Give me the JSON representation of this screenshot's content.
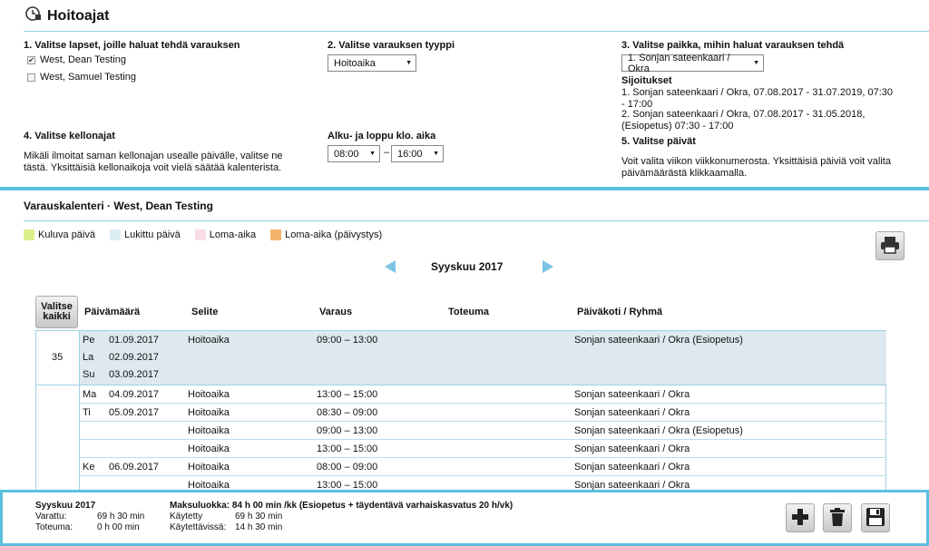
{
  "header": {
    "title": "Hoitoajat"
  },
  "section1": {
    "label": "1. Valitse lapset, joille haluat tehdä varauksen",
    "children": [
      {
        "name": "West, Dean Testing",
        "checked": true,
        "mark": "✔"
      },
      {
        "name": "West, Samuel Testing",
        "checked": false,
        "mark": ""
      }
    ]
  },
  "section2": {
    "label": "2. Valitse varauksen tyyppi",
    "selected": "Hoitoaika"
  },
  "section3": {
    "label": "3. Valitse paikka, mihin haluat varauksen tehdä",
    "selected": "1. Sonjan sateenkaari / Okra",
    "placements_title": "Sijoitukset",
    "placement1": "1. Sonjan sateenkaari / Okra, 07.08.2017 - 31.07.2019, 07:30 - 17:00",
    "placement2": "2. Sonjan sateenkaari / Okra, 07.08.2017 - 31.05.2018, (Esiopetus) 07:30 - 17:00"
  },
  "section4": {
    "label": "4. Valitse kellonajat",
    "help": "Mikäli ilmoitat saman kellonajan usealle päivälle, valitse ne tästä. Yksittäisiä kellonaikoja voit vielä säätää kalenterista."
  },
  "time": {
    "label": "Alku- ja loppu klo. aika",
    "start": "08:00",
    "dash": "–",
    "end": "16:00"
  },
  "section5": {
    "label": "5. Valitse päivät",
    "help": "Voit valita viikon viikkonumerosta. Yksittäisiä päiviä voit valita päivämäärästä klikkaamalla."
  },
  "calendar": {
    "title": "Varauskalenteri · West, Dean Testing",
    "legend": [
      {
        "label": "Kuluva päivä",
        "color": "#d9f08d"
      },
      {
        "label": "Lukittu päivä",
        "color": "#dbeef3"
      },
      {
        "label": "Loma-aika",
        "color": "#f8dde7"
      },
      {
        "label": "Loma-aika (päivystys)",
        "color": "#f4b36a"
      }
    ],
    "month": "Syyskuu 2017",
    "select_all": "Valitse kaikki",
    "columns": [
      "Päivämäärä",
      "Selite",
      "Varaus",
      "Toteuma",
      "Päiväkoti / Ryhmä"
    ],
    "week1": "35",
    "rows": [
      {
        "day": "Pe",
        "date": "01.09.2017",
        "type": "Hoitoaika",
        "time": "09:00  –  13:00",
        "unit": "Sonjan sateenkaari / Okra (Esiopetus)"
      },
      {
        "day": "La",
        "date": "02.09.2017",
        "type": "",
        "time": "",
        "unit": ""
      },
      {
        "day": "Su",
        "date": "03.09.2017",
        "type": "",
        "time": "",
        "unit": ""
      },
      {
        "day": "Ma",
        "date": "04.09.2017",
        "type": "Hoitoaika",
        "time": "13:00  –  15:00",
        "unit": "Sonjan sateenkaari / Okra"
      },
      {
        "day": "Ti",
        "date": "05.09.2017",
        "type": "Hoitoaika",
        "time": "08:30  –  09:00",
        "unit": "Sonjan sateenkaari / Okra"
      },
      {
        "day": "",
        "date": "",
        "type": "Hoitoaika",
        "time": "09:00  –  13:00",
        "unit": "Sonjan sateenkaari / Okra (Esiopetus)"
      },
      {
        "day": "",
        "date": "",
        "type": "Hoitoaika",
        "time": "13:00  –  15:00",
        "unit": "Sonjan sateenkaari / Okra"
      },
      {
        "day": "Ke",
        "date": "06.09.2017",
        "type": "Hoitoaika",
        "time": "08:00  –  09:00",
        "unit": "Sonjan sateenkaari / Okra"
      },
      {
        "day": "",
        "date": "",
        "type": "Hoitoaika",
        "time": "13:00  –  15:00",
        "unit": "Sonjan sateenkaari / Okra"
      }
    ]
  },
  "footer": {
    "month": "Syyskuu 2017",
    "reserved_label": "Varattu:",
    "reserved_value": "69 h 30 min",
    "realized_label": "Toteuma:",
    "realized_value": "0 h 00 min",
    "fee_line": "Maksuluokka: 84 h 00 min /kk (Esiopetus + täydentävä varhaiskasvatus 20 h/vk)",
    "used_label": "Käytetty",
    "used_value": "69 h 30 min",
    "available_label": "Käytettävissä:",
    "available_value": "14 h 30 min"
  }
}
